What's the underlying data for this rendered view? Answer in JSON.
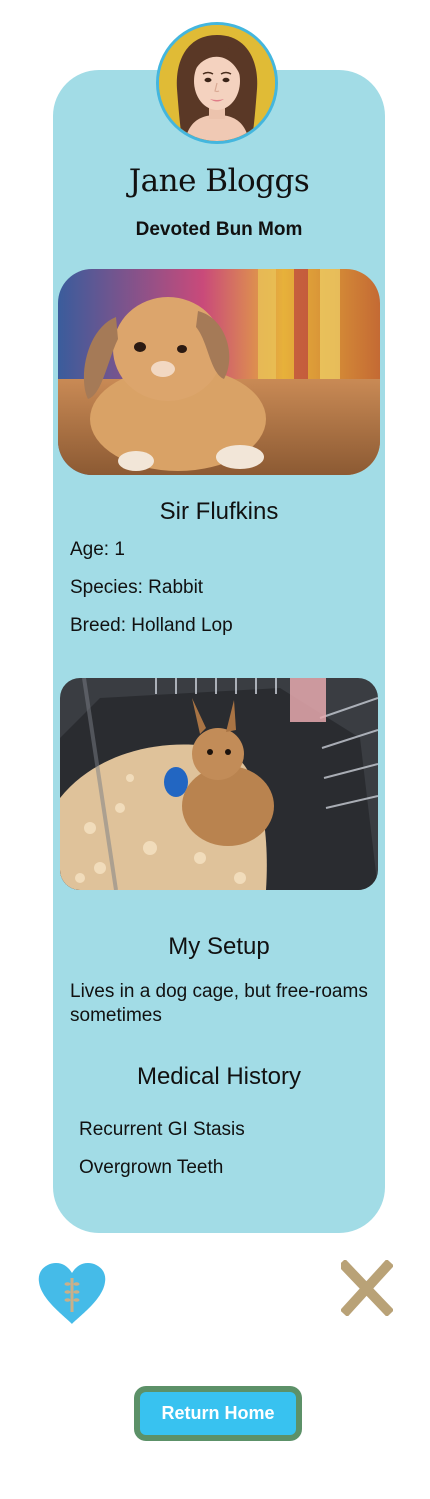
{
  "profile": {
    "name": "Jane Bloggs",
    "tagline": "Devoted Bun Mom"
  },
  "pet": {
    "name": "Sir Flufkins",
    "age": "Age: 1",
    "species": "Species: Rabbit",
    "breed": "Breed: Holland Lop"
  },
  "setup": {
    "title": "My Setup",
    "description": "Lives in a dog cage, but free-roams sometimes"
  },
  "medical": {
    "title": "Medical History",
    "items": [
      "Recurrent GI Stasis",
      "Overgrown Teeth"
    ]
  },
  "actions": {
    "like_icon": "heart-icon",
    "dismiss_icon": "close-icon",
    "return_home_label": "Return Home"
  },
  "colors": {
    "card": "#a2dce6",
    "heart": "#45bbe8",
    "close": "#b9a277",
    "button_outer": "#5c9168",
    "button_inner": "#38c2f0"
  }
}
